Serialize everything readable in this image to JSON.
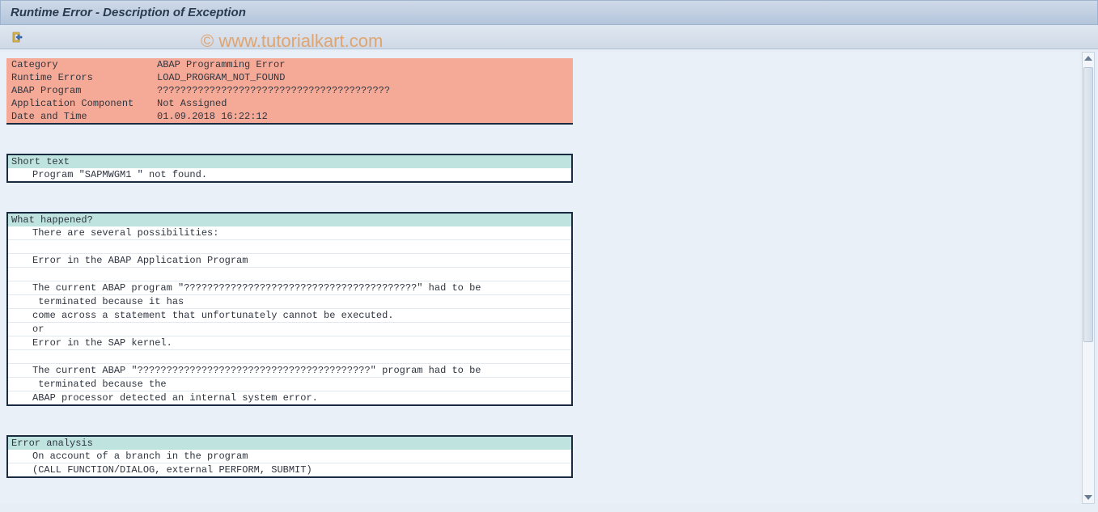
{
  "title": "Runtime Error - Description of Exception",
  "watermark": "© www.tutorialkart.com",
  "info_rows": [
    {
      "label": "Category",
      "value": "ABAP Programming Error"
    },
    {
      "label": "Runtime Errors",
      "value": "LOAD_PROGRAM_NOT_FOUND"
    },
    {
      "label": "ABAP Program",
      "value": "????????????????????????????????????????"
    },
    {
      "label": "Application Component",
      "value": "Not Assigned"
    },
    {
      "label": "Date and Time",
      "value": "01.09.2018 16:22:12"
    }
  ],
  "sections": [
    {
      "title": "Short text",
      "lines": [
        "Program \"SAPMWGM1 \" not found."
      ]
    },
    {
      "title": "What happened?",
      "lines": [
        "There are several possibilities:",
        "",
        "Error in the ABAP Application Program",
        "",
        "The current ABAP program \"????????????????????????????????????????\" had to be",
        " terminated because it has",
        "come across a statement that unfortunately cannot be executed.",
        "or",
        "Error in the SAP kernel.",
        "",
        "The current ABAP \"????????????????????????????????????????\" program had to be",
        " terminated because the",
        "ABAP processor detected an internal system error."
      ]
    },
    {
      "title": "Error analysis",
      "lines": [
        "On account of a branch in the program",
        "(CALL FUNCTION/DIALOG, external PERFORM, SUBMIT)"
      ]
    }
  ]
}
